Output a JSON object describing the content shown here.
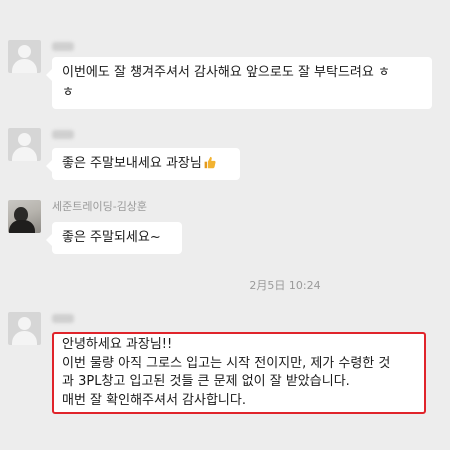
{
  "messages": [
    {
      "sender": "",
      "lines": [
        "이번에도 잘 챙겨주셔서 감사해요 앞으로도 잘 부탁드려요 ㅎ",
        "ㅎ"
      ]
    },
    {
      "sender": "",
      "text": "좋은 주말보내세요 과장님",
      "emoji": "thumbs-up-icon"
    },
    {
      "sender": "세준트레이딩-김상훈",
      "text": "좋은 주말되세요~"
    },
    {
      "sender": "",
      "lines": [
        "안녕하세요 과장님!!",
        "이번 물량 아직 그로스 입고는 시작 전이지만, 제가 수령한 것",
        "과 3PL창고 입고된 것들 큰 문제 없이 잘 받았습니다.",
        "매번 잘 확인해주셔서 감사합니다."
      ],
      "highlighted": true
    }
  ],
  "timestamp": "2月5日 10:24",
  "colors": {
    "background": "#ededed",
    "bubble": "#ffffff",
    "highlight_border": "#e0242b",
    "thumb": "#f2b230"
  }
}
